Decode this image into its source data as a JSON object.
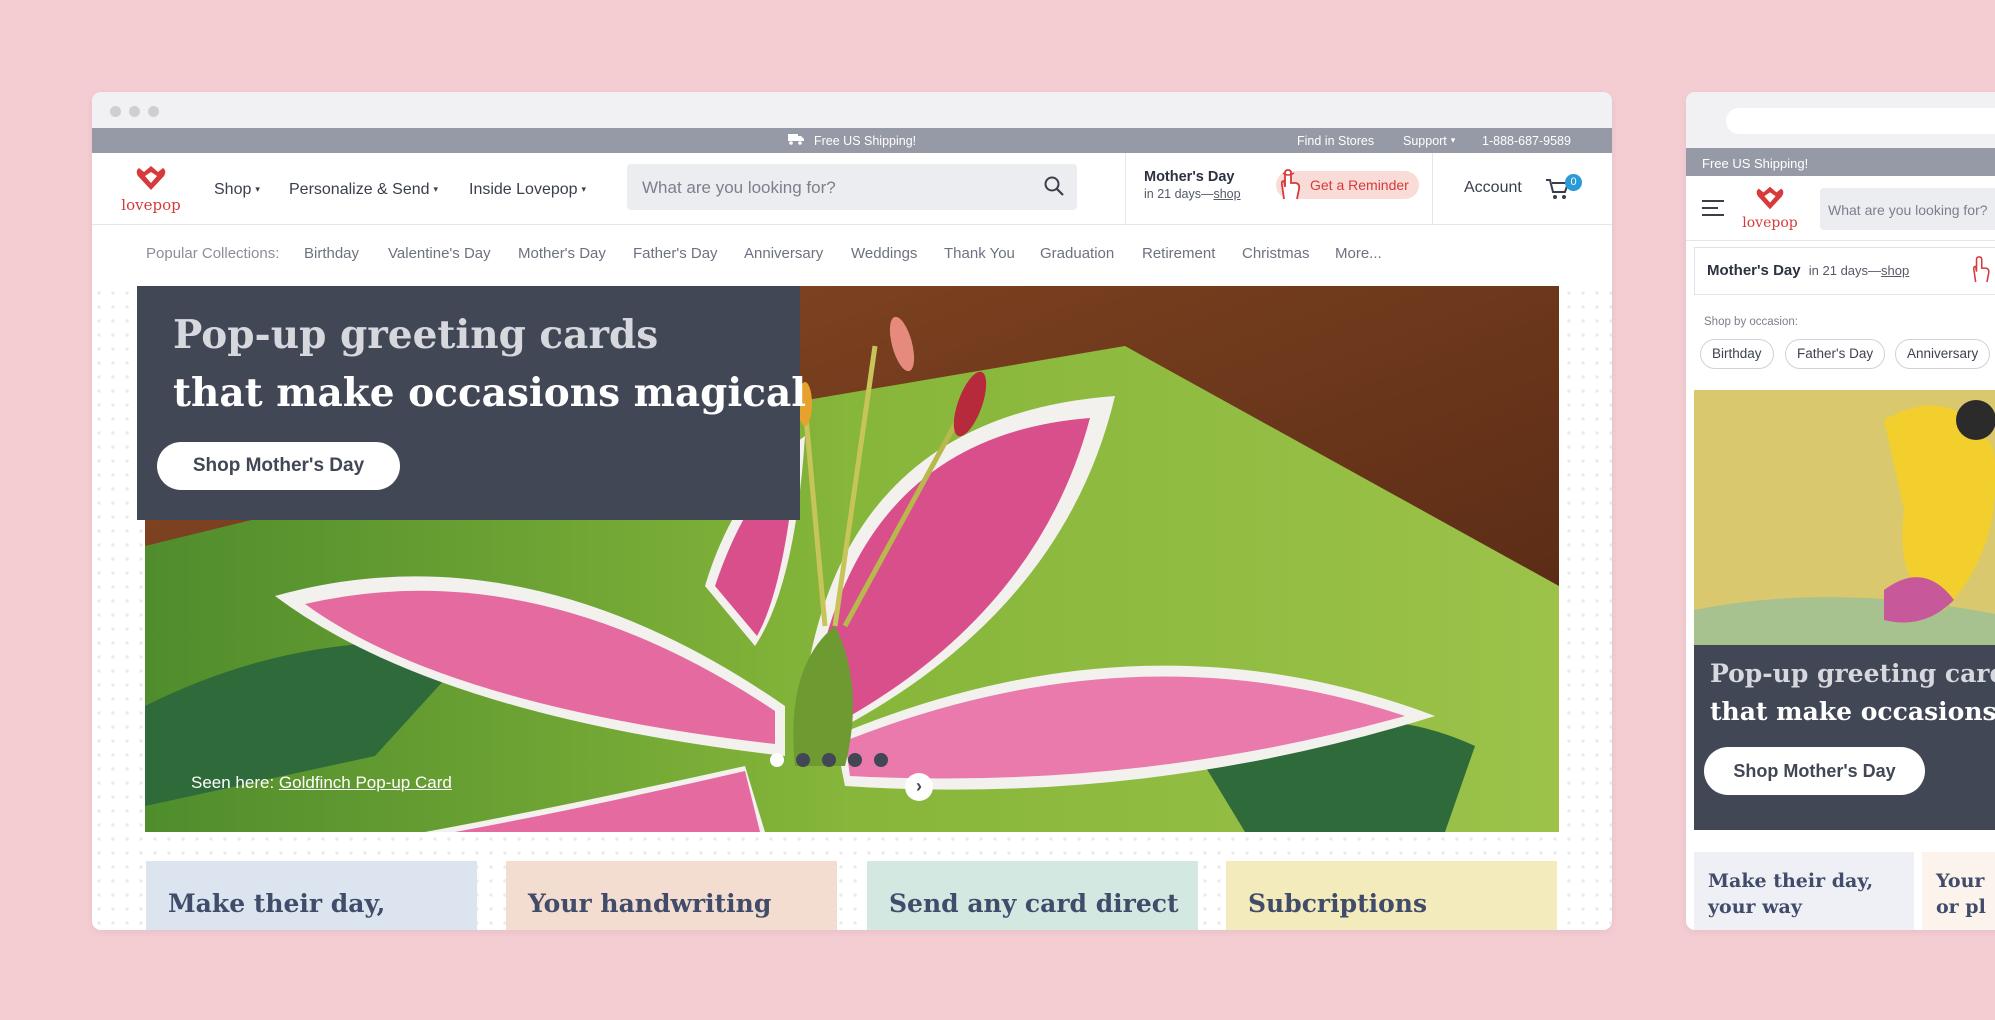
{
  "colors": {
    "background": "#f3cdd2",
    "topbar": "#969aa6",
    "panel": "#414755",
    "accent": "#d63a3a",
    "badge": "#2a9ad8"
  },
  "desktop": {
    "topbar": {
      "shipping": "Free US Shipping!",
      "find": "Find in Stores",
      "support": "Support",
      "phone": "1-888-687-9589"
    },
    "logo": "lovepop",
    "nav": {
      "shop": "Shop",
      "personalize": "Personalize & Send",
      "inside": "Inside Lovepop"
    },
    "search": {
      "placeholder": "What are you looking for?",
      "icon": "search-icon"
    },
    "promo": {
      "title": "Mother's Day",
      "days": "in 21 days—",
      "link": "shop",
      "reminder": "Get a Reminder"
    },
    "account": "Account",
    "cart_count": "0",
    "collections": {
      "label": "Popular Collections:",
      "items": [
        "Birthday",
        "Valentine's Day",
        "Mother's Day",
        "Father's Day",
        "Anniversary",
        "Weddings",
        "Thank You",
        "Graduation",
        "Retirement",
        "Christmas",
        "More..."
      ]
    },
    "hero": {
      "line1": "Pop-up greeting cards",
      "line2": "that make occasions magical",
      "cta": "Shop Mother's Day",
      "seen_prefix": "Seen here: ",
      "seen_link": "Goldfinch Pop-up Card",
      "slide_count": 5,
      "active_slide": 1
    },
    "cards": [
      {
        "title": "Make their day,",
        "color": "#dce4ef"
      },
      {
        "title": "Your handwriting",
        "color": "#f3ddd0"
      },
      {
        "title": "Send any card direct",
        "color": "#d3e8e1"
      },
      {
        "title": "Subcriptions",
        "color": "#f4ebbc"
      }
    ]
  },
  "mobile": {
    "shipping": "Free US Shipping!",
    "logo": "lovepop",
    "search_placeholder": "What are you looking for?",
    "promo": {
      "title": "Mother's Day",
      "days": "in 21 days—",
      "link": "shop"
    },
    "occasion_label": "Shop by occasion:",
    "chips": [
      "Birthday",
      "Father's Day",
      "Anniversary"
    ],
    "hero": {
      "line1": "Pop-up greeting card",
      "line2": "that make occasions",
      "cta": "Shop Mother's Day"
    },
    "cards": [
      {
        "line1": "Make their day,",
        "line2": "your way"
      },
      {
        "line1": "Your",
        "line2": "or pl"
      }
    ]
  }
}
